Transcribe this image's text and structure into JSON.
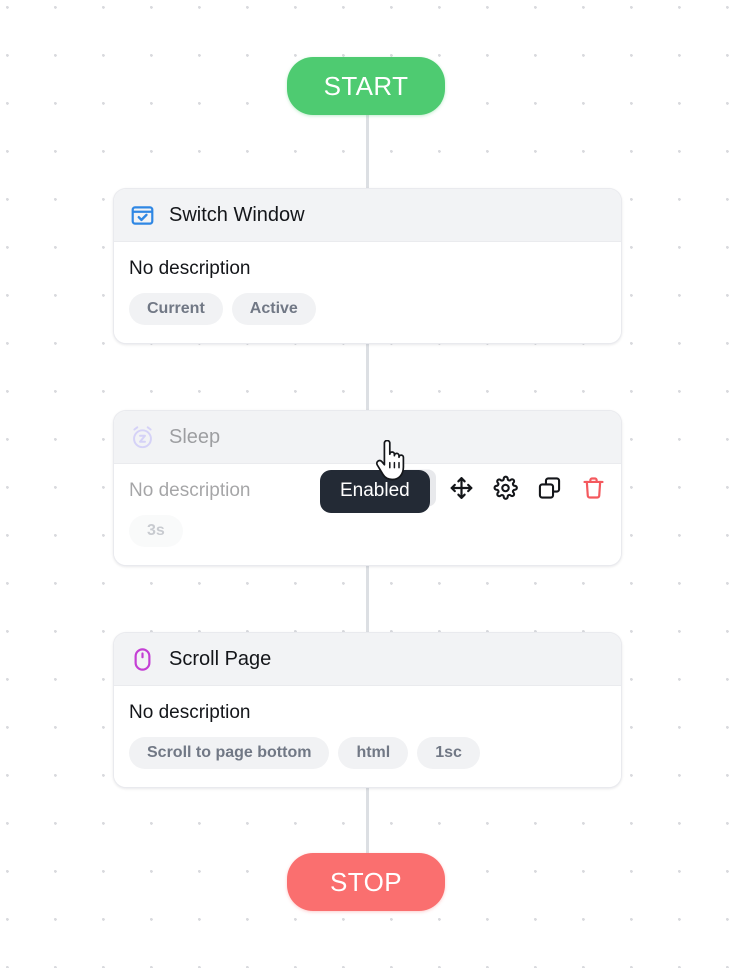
{
  "flow": {
    "start_label": "START",
    "stop_label": "STOP",
    "start_color": "#4ecb71",
    "stop_color": "#fa6f6f",
    "connector_color": "#dcdfe3",
    "canvas_background": "#ffffff",
    "grid_dot_color": "#d9dade"
  },
  "blocks": [
    {
      "id": "switch-window",
      "icon": "window-check-icon",
      "icon_color": "#2f87e4",
      "title": "Switch Window",
      "description": "No description",
      "chips": [
        "Current",
        "Active"
      ],
      "enabled": true
    },
    {
      "id": "sleep",
      "icon": "alarm-snooze-icon",
      "icon_color": "#a79dfb",
      "title": "Sleep",
      "description": "No description",
      "chips": [
        "3s"
      ],
      "enabled": false
    },
    {
      "id": "scroll-page",
      "icon": "mouse-icon",
      "icon_color": "#c43fd4",
      "title": "Scroll Page",
      "description": "No description",
      "chips": [
        "Scroll to page bottom",
        "html",
        "1sc"
      ],
      "enabled": true
    }
  ],
  "toolbar": {
    "buttons": [
      {
        "name": "toggle-enabled-button",
        "icon": "eye-off-icon",
        "hovered": true
      },
      {
        "name": "move-button",
        "icon": "move-arrows-icon",
        "hovered": false
      },
      {
        "name": "settings-button",
        "icon": "gear-icon",
        "hovered": false
      },
      {
        "name": "duplicate-button",
        "icon": "copy-icon",
        "hovered": false
      },
      {
        "name": "delete-button",
        "icon": "trash-icon",
        "hovered": false
      }
    ],
    "delete_color": "#f4595e",
    "hover_background": "#e8e9ec"
  },
  "tooltip": {
    "label": "Enabled",
    "background": "#232a35",
    "text_color": "#ffffff"
  },
  "cursor": {
    "type": "pointing-hand-cursor"
  }
}
